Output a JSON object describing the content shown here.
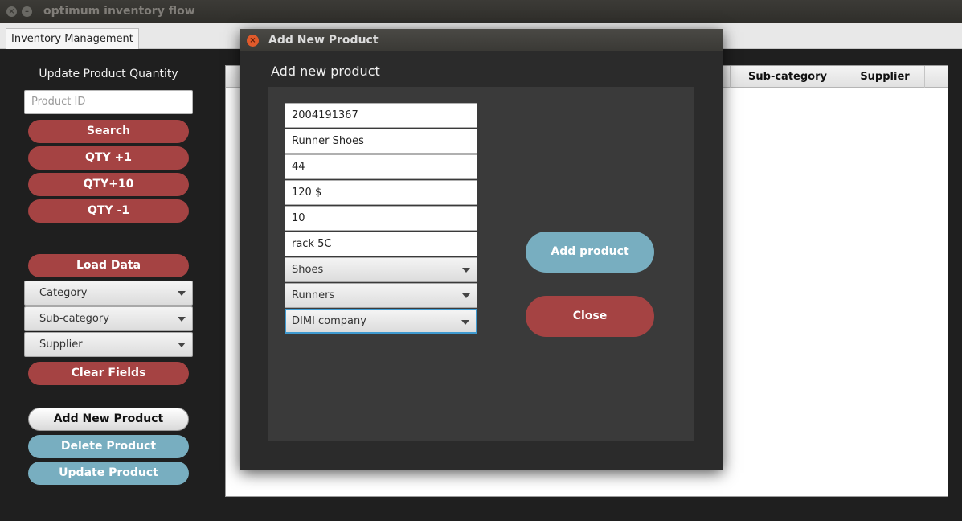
{
  "window": {
    "title": "optimum inventory flow",
    "close_glyph": "×",
    "min_glyph": "–",
    "tab": "Inventory Management"
  },
  "sidebar": {
    "title": "Update Product Quantity",
    "product_id_placeholder": "Product ID",
    "search": "Search",
    "qty_plus1": "QTY +1",
    "qty_plus10": "QTY+10",
    "qty_minus1": "QTY -1",
    "load_data": "Load Data",
    "category": "Category",
    "subcategory": "Sub-category",
    "supplier": "Supplier",
    "clear_fields": "Clear Fields",
    "add_new_product": "Add New Product",
    "delete_product": "Delete Product",
    "update_product": "Update Product"
  },
  "table": {
    "columns": [
      "Sub-category",
      "Supplier"
    ]
  },
  "dialog": {
    "title": "Add New Product",
    "close_glyph": "×",
    "heading": "Add new product",
    "fields": {
      "id": "2004191367",
      "name": "Runner Shoes",
      "size": "44",
      "price": "120 $",
      "quantity": "10",
      "location": "rack 5C"
    },
    "combos": {
      "category": "Shoes",
      "subcategory": "Runners",
      "supplier": "DIMI company"
    },
    "add_button": "Add product",
    "close_button": "Close"
  },
  "colors": {
    "red_button": "#a54343",
    "blue_button": "#78aec0",
    "focus_border": "#3f9ad0"
  }
}
